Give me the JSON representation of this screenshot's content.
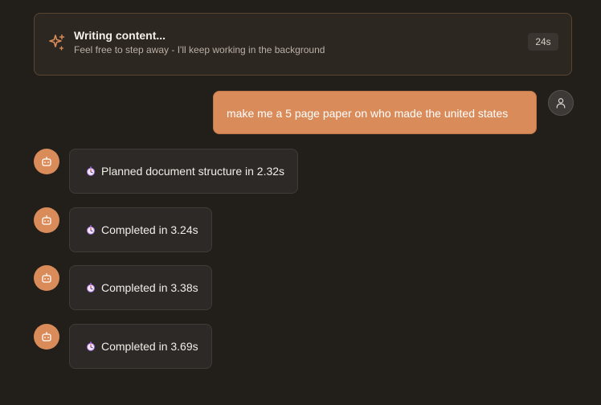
{
  "banner": {
    "title": "Writing content...",
    "subtitle": "Feel free to step away - I'll keep working in the background",
    "timer": "24s",
    "icon": "sparkle-icon"
  },
  "user_message": {
    "text": "make me a 5 page paper on who made the united states",
    "avatar_icon": "user-icon"
  },
  "assistant_messages": [
    {
      "text": "Planned document structure in 2.32s",
      "icon": "stopwatch-icon"
    },
    {
      "text": "Completed in 3.24s",
      "icon": "stopwatch-icon"
    },
    {
      "text": "Completed in 3.38s",
      "icon": "stopwatch-icon"
    },
    {
      "text": "Completed in 3.69s",
      "icon": "stopwatch-icon"
    }
  ],
  "colors": {
    "accent": "#d98b59",
    "background": "#221f1b",
    "bubble": "#2c2926"
  }
}
